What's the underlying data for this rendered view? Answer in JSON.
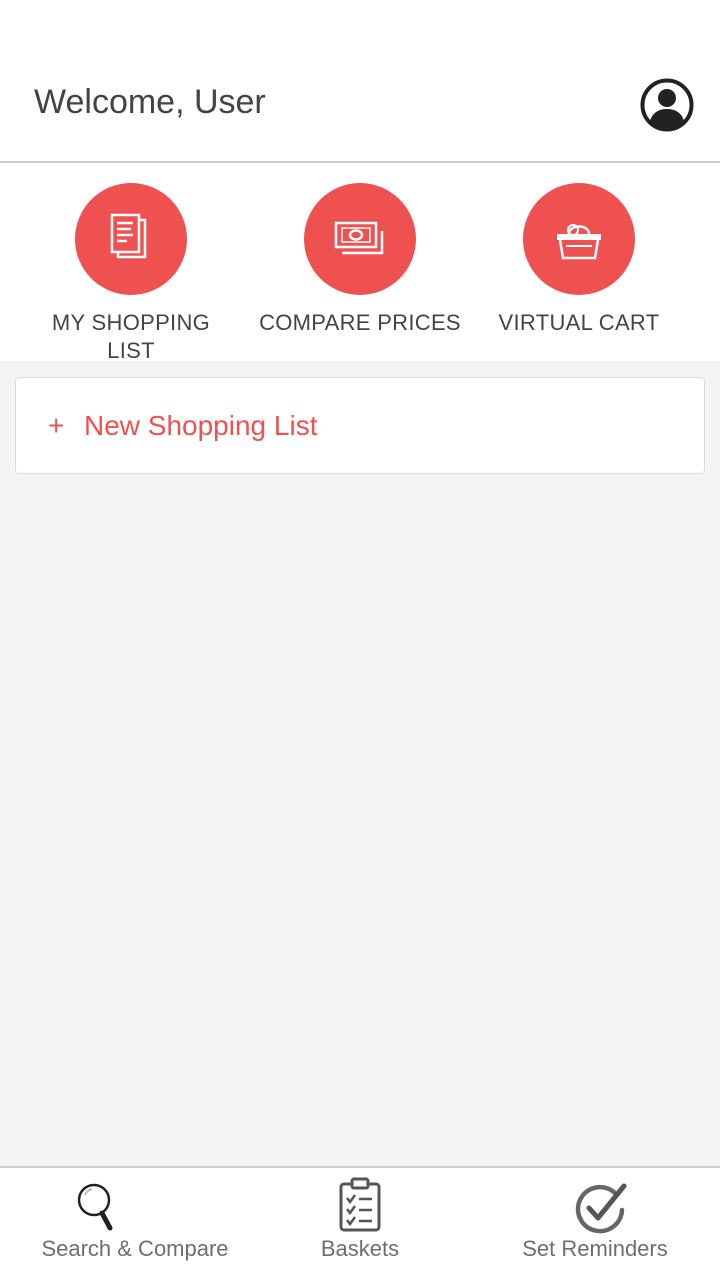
{
  "header": {
    "welcome_text": "Welcome, User",
    "profile_icon": "account-circle-icon"
  },
  "actions": [
    {
      "label": "MY SHOPPING\nLIST",
      "icon": "document-list-icon"
    },
    {
      "label": "COMPARE PRICES",
      "icon": "money-bills-icon"
    },
    {
      "label": "VIRTUAL CART",
      "icon": "shopping-basket-icon"
    }
  ],
  "new_list": {
    "plus": "+",
    "label": "New Shopping List"
  },
  "bottom_nav": [
    {
      "label": "Search & Compare",
      "icon": "magnifier-icon"
    },
    {
      "label": "Baskets",
      "icon": "clipboard-checklist-icon"
    },
    {
      "label": "Set Reminders",
      "icon": "check-circle-icon"
    }
  ],
  "colors": {
    "accent": "#ef5050",
    "text": "#444444",
    "background": "#f4f4f4"
  }
}
